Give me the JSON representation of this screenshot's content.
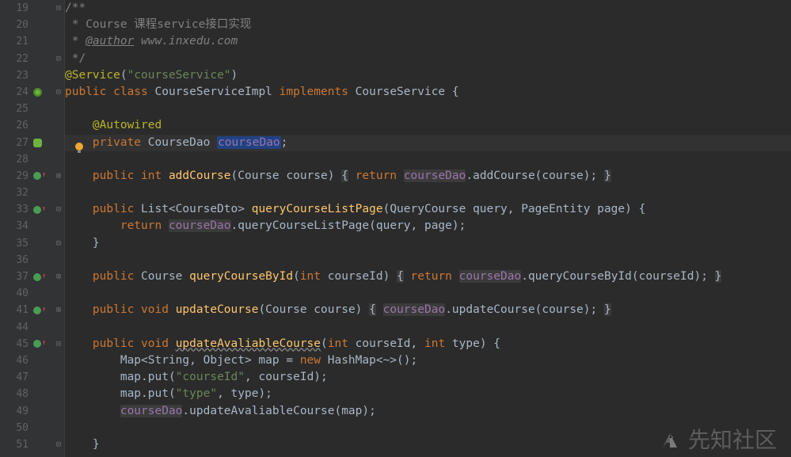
{
  "lines": [
    {
      "n": 19,
      "fold": "⊟",
      "code": [
        [
          "cmt",
          "/**"
        ]
      ]
    },
    {
      "n": 20,
      "code": [
        [
          "cmt",
          " * Course 课程service接口实现"
        ]
      ]
    },
    {
      "n": 21,
      "code": [
        [
          "cmt",
          " * "
        ],
        [
          "cmt-tag",
          "@author"
        ],
        [
          "cmt-val",
          " www.inxedu.com"
        ]
      ]
    },
    {
      "n": 22,
      "fold": "⊟",
      "code": [
        [
          "cmt",
          " */"
        ]
      ]
    },
    {
      "n": 23,
      "code": [
        [
          "ann",
          "@Service"
        ],
        [
          "ident",
          "("
        ],
        [
          "str",
          "\"courseService\""
        ],
        [
          "ident",
          ")"
        ]
      ]
    },
    {
      "n": 24,
      "icon": "spring",
      "fold": "⊟",
      "code": [
        [
          "kw",
          "public class "
        ],
        [
          "type",
          "CourseServiceImpl "
        ],
        [
          "kw",
          "implements "
        ],
        [
          "type",
          "CourseService {"
        ]
      ]
    },
    {
      "n": 25,
      "code": []
    },
    {
      "n": 26,
      "code": [
        [
          "ident",
          "    "
        ],
        [
          "ann",
          "@Autowired"
        ]
      ]
    },
    {
      "n": 27,
      "icon": "bean",
      "bulb": true,
      "hl": true,
      "code": [
        [
          "ident",
          "    "
        ],
        [
          "kw",
          "private "
        ],
        [
          "type",
          "CourseDao "
        ],
        [
          "sel-field",
          "courseDao"
        ],
        [
          "ident",
          ";"
        ]
      ]
    },
    {
      "n": 28,
      "code": []
    },
    {
      "n": 29,
      "icon": "impl-red",
      "fold": "⊞",
      "code": [
        [
          "ident",
          "    "
        ],
        [
          "kw",
          "public int "
        ],
        [
          "fn",
          "addCourse"
        ],
        [
          "ident",
          "(Course course) "
        ],
        [
          "boxed",
          "{"
        ],
        [
          "ident",
          " "
        ],
        [
          "kw",
          "return "
        ],
        [
          "boxed-field",
          "courseDao"
        ],
        [
          "ident",
          ".addCourse(course); "
        ],
        [
          "boxed",
          "}"
        ]
      ]
    },
    {
      "n": 32,
      "code": []
    },
    {
      "n": 33,
      "icon": "impl-red",
      "fold": "⊟",
      "code": [
        [
          "ident",
          "    "
        ],
        [
          "kw",
          "public "
        ],
        [
          "type",
          "List<CourseDto> "
        ],
        [
          "fn",
          "queryCourseListPage"
        ],
        [
          "ident",
          "(QueryCourse query, PageEntity page) {"
        ]
      ]
    },
    {
      "n": 34,
      "code": [
        [
          "ident",
          "        "
        ],
        [
          "kw",
          "return "
        ],
        [
          "boxed-field",
          "courseDao"
        ],
        [
          "ident",
          ".queryCourseListPage(query, page);"
        ]
      ]
    },
    {
      "n": 35,
      "fold": "⊟",
      "code": [
        [
          "ident",
          "    }"
        ]
      ]
    },
    {
      "n": 36,
      "code": []
    },
    {
      "n": 37,
      "icon": "impl-red",
      "fold": "⊞",
      "code": [
        [
          "ident",
          "    "
        ],
        [
          "kw",
          "public "
        ],
        [
          "type",
          "Course "
        ],
        [
          "fn",
          "queryCourseById"
        ],
        [
          "ident",
          "("
        ],
        [
          "kw",
          "int "
        ],
        [
          "ident",
          "courseId) "
        ],
        [
          "boxed",
          "{"
        ],
        [
          "ident",
          " "
        ],
        [
          "kw",
          "return "
        ],
        [
          "boxed-field",
          "courseDao"
        ],
        [
          "ident",
          ".queryCourseById(courseId); "
        ],
        [
          "boxed",
          "}"
        ]
      ]
    },
    {
      "n": 40,
      "code": []
    },
    {
      "n": 41,
      "icon": "impl-red",
      "fold": "⊞",
      "code": [
        [
          "ident",
          "    "
        ],
        [
          "kw",
          "public void "
        ],
        [
          "fn",
          "updateCourse"
        ],
        [
          "ident",
          "(Course course) "
        ],
        [
          "boxed",
          "{"
        ],
        [
          "ident",
          " "
        ],
        [
          "boxed-field",
          "courseDao"
        ],
        [
          "ident",
          ".updateCourse(course); "
        ],
        [
          "boxed",
          "}"
        ]
      ]
    },
    {
      "n": 44,
      "code": []
    },
    {
      "n": 45,
      "icon": "impl-red",
      "fold": "⊟",
      "code": [
        [
          "ident",
          "    "
        ],
        [
          "kw",
          "public void "
        ],
        [
          "fn-wavy",
          "updateAvaliableCourse"
        ],
        [
          "ident",
          "("
        ],
        [
          "kw",
          "int "
        ],
        [
          "ident",
          "courseId, "
        ],
        [
          "kw",
          "int "
        ],
        [
          "ident",
          "type) {"
        ]
      ]
    },
    {
      "n": 46,
      "code": [
        [
          "ident",
          "        Map<String, Object> map = "
        ],
        [
          "kw",
          "new "
        ],
        [
          "type",
          "HashMap"
        ],
        [
          "ident",
          "<~>();"
        ]
      ]
    },
    {
      "n": 47,
      "code": [
        [
          "ident",
          "        map.put("
        ],
        [
          "str",
          "\"courseId\""
        ],
        [
          "ident",
          ", courseId);"
        ]
      ]
    },
    {
      "n": 48,
      "code": [
        [
          "ident",
          "        map.put("
        ],
        [
          "str",
          "\"type\""
        ],
        [
          "ident",
          ", type);"
        ]
      ]
    },
    {
      "n": 49,
      "code": [
        [
          "ident",
          "        "
        ],
        [
          "boxed-field",
          "courseDao"
        ],
        [
          "ident",
          ".updateAvaliableCourse(map);"
        ]
      ]
    },
    {
      "n": 50,
      "code": []
    },
    {
      "n": 51,
      "fold": "⊟",
      "code": [
        [
          "ident",
          "    }"
        ]
      ]
    }
  ],
  "watermark": "先知社区"
}
